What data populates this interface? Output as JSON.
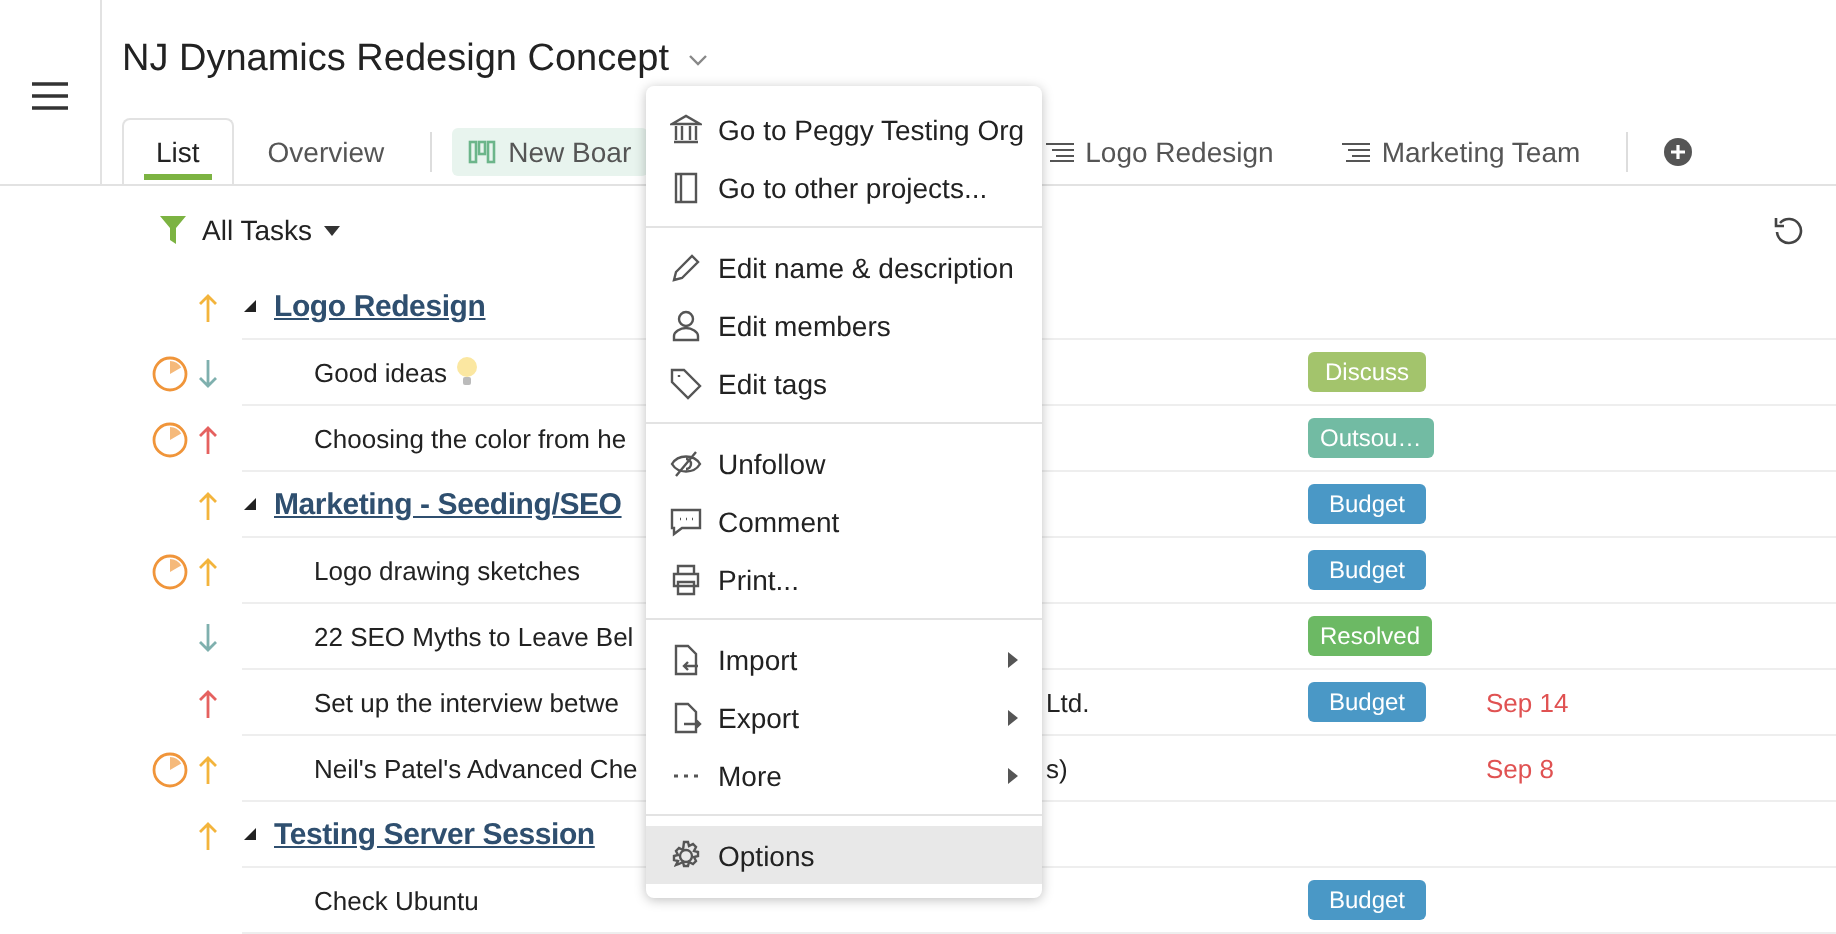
{
  "project": {
    "title": "NJ Dynamics Redesign Concept"
  },
  "tabs": [
    {
      "label": "List",
      "kind": "plain",
      "selected": true
    },
    {
      "label": "Overview",
      "kind": "plain",
      "selected": false
    },
    {
      "label": "New Boar",
      "kind": "board",
      "selected": false
    },
    {
      "label": "Logo Redesign",
      "kind": "list",
      "selected": false
    },
    {
      "label": "Marketing Team",
      "kind": "list",
      "selected": false
    }
  ],
  "filter": {
    "label": "All Tasks"
  },
  "rows": [
    {
      "kind": "group",
      "arrow": {
        "up": true,
        "color": "#f3b43c"
      },
      "title": "Logo Redesign"
    },
    {
      "kind": "task",
      "timer": true,
      "arrow": {
        "up": false,
        "color": "#7fb0ae"
      },
      "title": "Good ideas",
      "bulb": true,
      "tag": {
        "label": "Discuss",
        "color": "#a3c46c"
      }
    },
    {
      "kind": "task",
      "timer": true,
      "arrow": {
        "up": true,
        "color": "#e5615f"
      },
      "title": "Choosing the color from he",
      "tag": {
        "label": "Outsou…",
        "color": "#72bba3"
      }
    },
    {
      "kind": "group",
      "arrow": {
        "up": true,
        "color": "#f3b43c"
      },
      "title": "Marketing - Seeding/SEO",
      "tag": {
        "label": "Budget",
        "color": "#4a98c6"
      }
    },
    {
      "kind": "task",
      "timer": true,
      "arrow": {
        "up": true,
        "color": "#f3b43c"
      },
      "title": "Logo drawing sketches",
      "tag": {
        "label": "Budget",
        "color": "#4a98c6"
      }
    },
    {
      "kind": "task",
      "timer": false,
      "arrow": {
        "up": false,
        "color": "#7fb0ae"
      },
      "title": "22 SEO Myths to Leave Bel",
      "tag": {
        "label": "Resolved",
        "color": "#6cb964"
      }
    },
    {
      "kind": "task",
      "timer": false,
      "arrow": {
        "up": true,
        "color": "#e5615f"
      },
      "title": "Set up the interview betwe",
      "tail": "Ltd.",
      "tag": {
        "label": "Budget",
        "color": "#4a98c6"
      },
      "date": "Sep 14"
    },
    {
      "kind": "task",
      "timer": true,
      "arrow": {
        "up": true,
        "color": "#f3b43c"
      },
      "title": "Neil's Patel's Advanced Che",
      "tail": "s)",
      "date": "Sep 8"
    },
    {
      "kind": "group",
      "arrow": {
        "up": true,
        "color": "#f3b43c"
      },
      "title": "Testing Server Session"
    },
    {
      "kind": "task",
      "timer": false,
      "title": "Check Ubuntu",
      "tag": {
        "label": "Budget",
        "color": "#4a98c6"
      }
    }
  ],
  "menu": {
    "groups": [
      [
        {
          "label": "Go to Peggy Testing Org",
          "submenu": false,
          "selected": false
        },
        {
          "label": "Go to other projects...",
          "submenu": false,
          "selected": false
        }
      ],
      [
        {
          "label": "Edit name & description",
          "submenu": false,
          "selected": false
        },
        {
          "label": "Edit members",
          "submenu": false,
          "selected": false
        },
        {
          "label": "Edit tags",
          "submenu": false,
          "selected": false
        }
      ],
      [
        {
          "label": "Unfollow",
          "submenu": false,
          "selected": false
        },
        {
          "label": "Comment",
          "submenu": false,
          "selected": false
        },
        {
          "label": "Print...",
          "submenu": false,
          "selected": false
        }
      ],
      [
        {
          "label": "Import",
          "submenu": true,
          "selected": false
        },
        {
          "label": "Export",
          "submenu": true,
          "selected": false
        },
        {
          "label": "More",
          "submenu": true,
          "selected": false
        }
      ],
      [
        {
          "label": "Options",
          "submenu": false,
          "selected": true
        }
      ]
    ]
  }
}
